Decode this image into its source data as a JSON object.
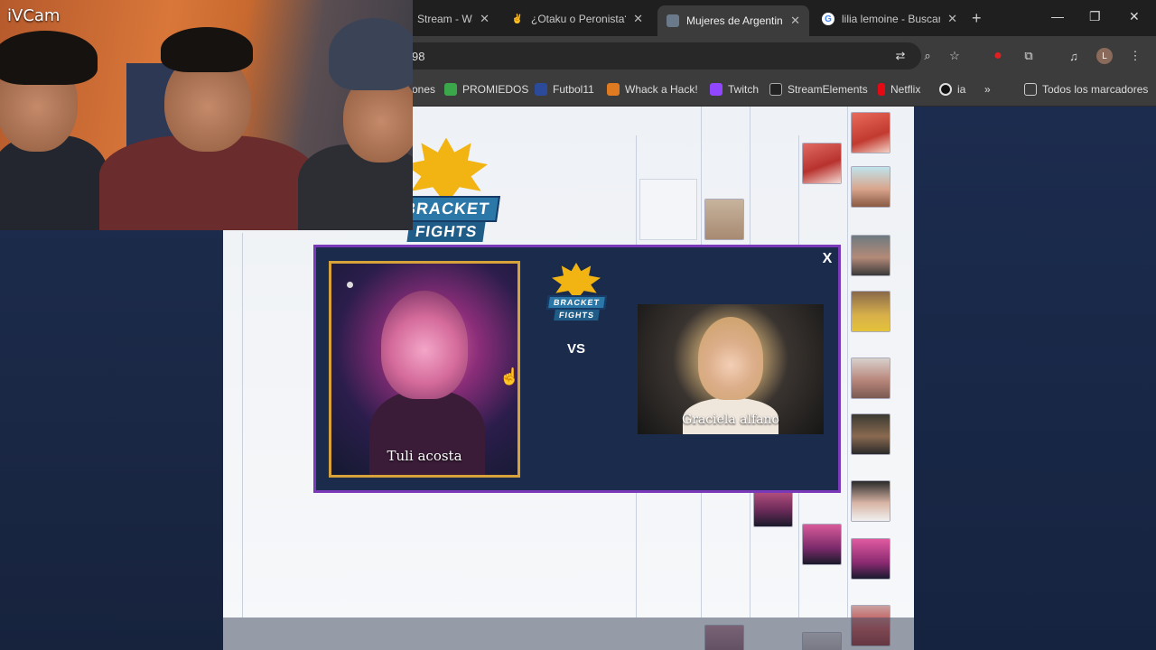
{
  "webcam": {
    "label": "iVCam"
  },
  "tabs": [
    {
      "title": "Stream - Wa",
      "icon": "stream-favicon",
      "active": false
    },
    {
      "title": "¿Otaku o Peronista?",
      "icon": "victory-hand-favicon",
      "active": false
    },
    {
      "title": "Mujeres de Argentina",
      "icon": "bracket-favicon",
      "active": true
    },
    {
      "title": "lilia lemoine - Buscar",
      "icon": "google-favicon",
      "active": false
    }
  ],
  "new_tab_symbol": "+",
  "window_controls": {
    "minimize": "—",
    "restore": "❐",
    "close": "✕"
  },
  "address": {
    "url_fragment": "98"
  },
  "bookmarks": [
    {
      "label": "ones",
      "icon": "cut-off"
    },
    {
      "label": "PROMIEDOS",
      "icon": "promiedos-icon",
      "color": "#3aa84a"
    },
    {
      "label": "Futbol11",
      "icon": "futbol11-icon",
      "color": "#2b4a9a"
    },
    {
      "label": "Whack a Hack!",
      "icon": "whack-icon",
      "color": "#e07a20"
    },
    {
      "label": "Twitch",
      "icon": "twitch-icon",
      "color": "#9146ff"
    },
    {
      "label": "StreamElements",
      "icon": "streamelements-icon",
      "color": "#222222"
    },
    {
      "label": "Netflix",
      "icon": "netflix-icon",
      "color": "#e50914"
    },
    {
      "label": "ia",
      "icon": "ia-icon",
      "color": "#111111"
    }
  ],
  "bookmarks_overflow": "»",
  "bookmarks_folder": {
    "label": "Todos los marcadores",
    "icon": "folder-icon"
  },
  "profile_initial": "L",
  "logo": {
    "line1": "BRACKET",
    "line2": "FIGHTS"
  },
  "matchup": {
    "left": {
      "name": "Tuli acosta"
    },
    "right": {
      "name": "Graciela alfano"
    },
    "vs_label": "VS",
    "close_label": "X"
  },
  "colors": {
    "modal_border": "#7a39b8",
    "modal_bg": "#1a2b4c",
    "selected_card_border": "#d8a23a",
    "page_bg": "#1b2a4a"
  }
}
